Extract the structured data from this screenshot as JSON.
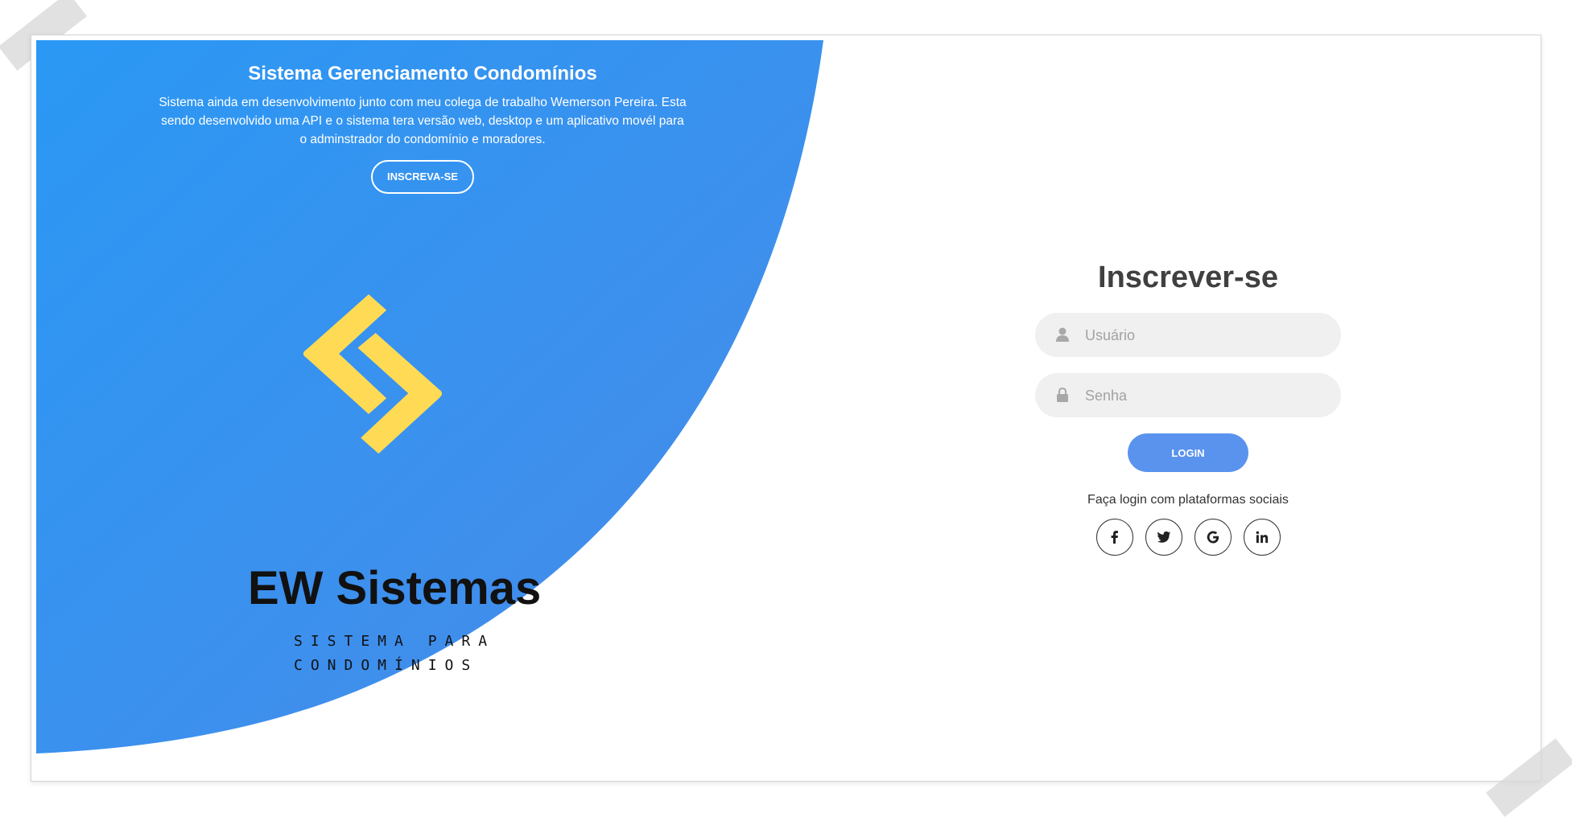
{
  "colors": {
    "panel_gradient_start": "#2a98f4",
    "panel_gradient_end": "#4a8ae8",
    "logo_yellow": "#ffdb55",
    "login_button": "#5a93ee",
    "field_bg": "#f0f0f0"
  },
  "hero": {
    "title": "Sistema Gerenciamento Condomínios",
    "description": "Sistema ainda em desenvolvimento junto com meu colega de trabalho Wemerson Pereira. Esta sendo desenvolvido uma API e o sistema tera versão web, desktop e um aplicativo movél para o adminstrador do condomínio e moradores.",
    "signup_button": "INSCREVA-SE"
  },
  "logo": {
    "name": "EW Sistemas",
    "subtitle_line1": "SISTEMA PARA",
    "subtitle_line2": "CONDOMÍNIOS"
  },
  "form": {
    "title": "Inscrever-se",
    "username_placeholder": "Usuário",
    "password_placeholder": "Senha",
    "login_button": "LOGIN",
    "social_text": "Faça login com plataformas sociais",
    "social_icons": [
      "facebook-icon",
      "twitter-icon",
      "google-icon",
      "linkedin-icon"
    ]
  }
}
